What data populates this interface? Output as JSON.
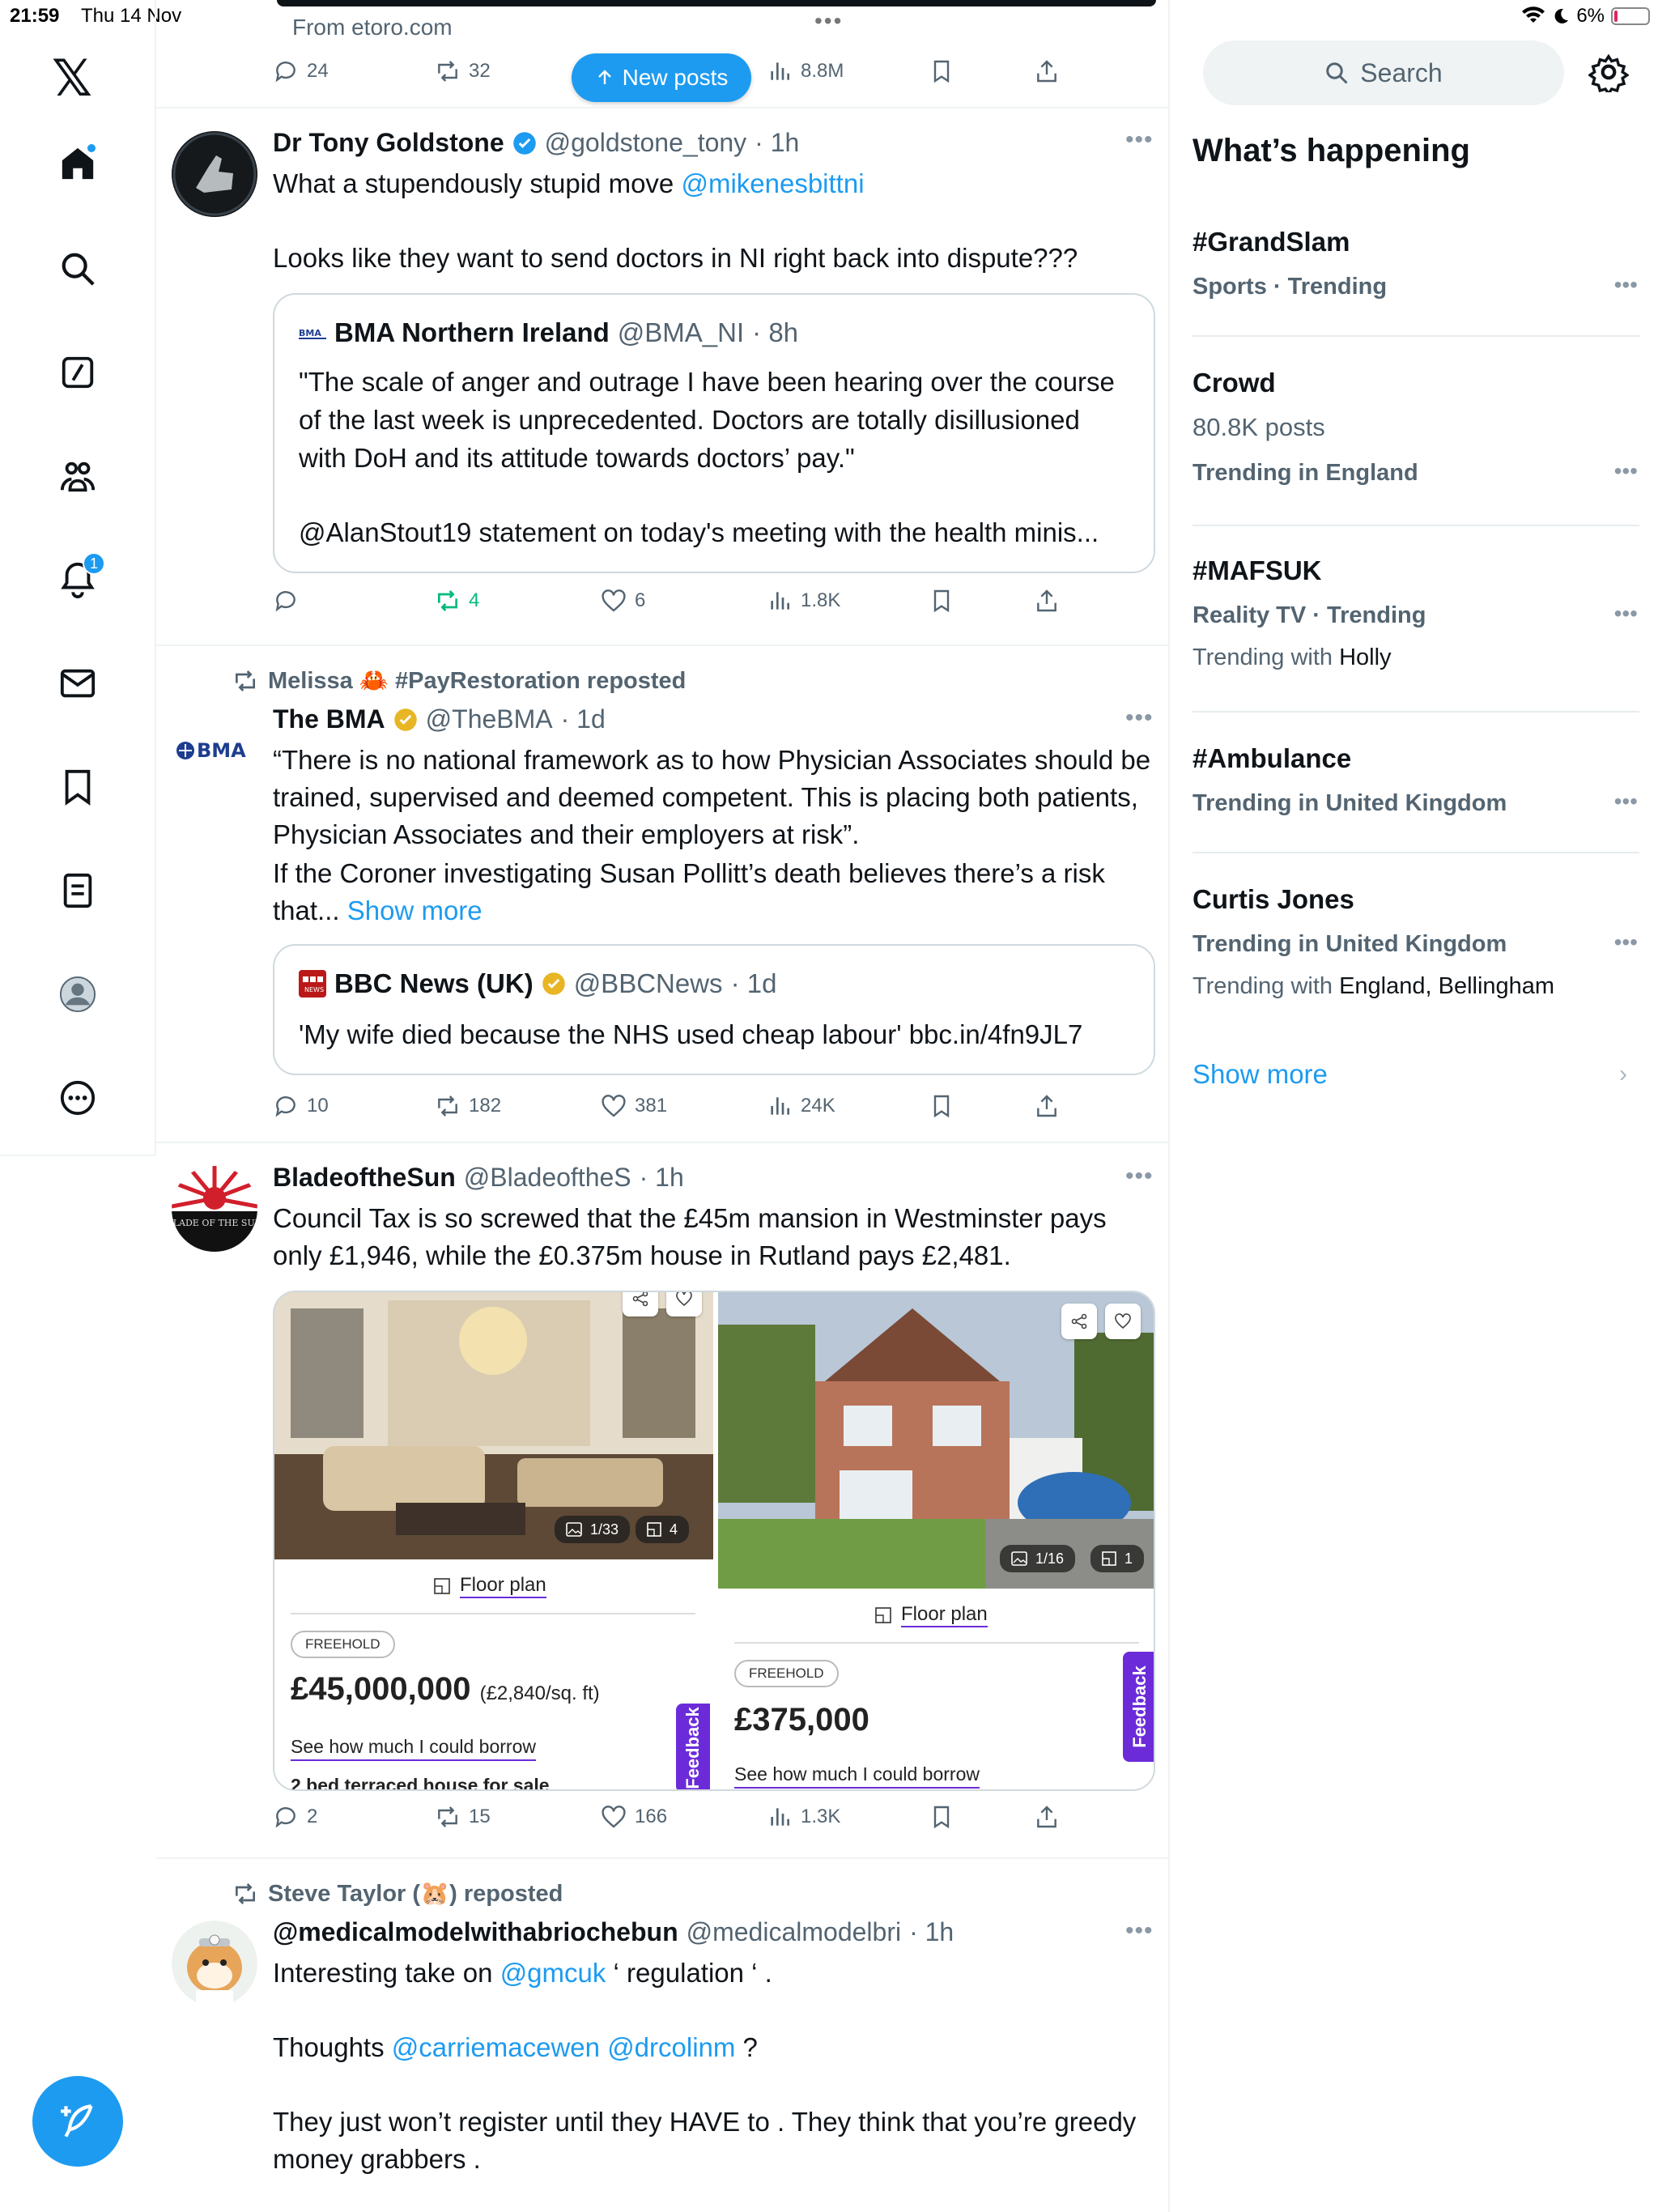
{
  "status_bar": {
    "time": "21:59",
    "date": "Thu 14 Nov",
    "battery": "6%"
  },
  "nav": {
    "notifications_badge": "1"
  },
  "ad": {
    "from": "From etoro.com",
    "replies": "24",
    "reposts": "32",
    "views": "8.8M"
  },
  "new_posts_label": "New posts",
  "search": {
    "placeholder": "Search"
  },
  "tweets": [
    {
      "name": "Dr Tony Goldstone",
      "handle": "@goldstone_tony",
      "time": "· 1h",
      "text_line1": "What a stupendously stupid move ",
      "mention": "@mikenesbittni",
      "text_line2": "Looks like they want to send doctors in NI right back into dispute???",
      "quote": {
        "name": "BMA Northern Ireland",
        "handle": "@BMA_NI",
        "time": "· 8h",
        "text1": "\"The scale of anger and outrage I have been hearing over the course of the last week is unprecedented. Doctors are totally disillusioned with DoH and its attitude towards doctors’ pay.\"",
        "text2": "@AlanStout19 statement on today's meeting with the health minis..."
      },
      "replies": "",
      "reposts": "4",
      "likes": "6",
      "views": "1.8K"
    },
    {
      "repost_by": "Melissa 🦀 #PayRestoration reposted",
      "name": "The BMA",
      "handle": "@TheBMA",
      "time": "· 1d",
      "avatar_text": "BMA",
      "text": "“There is no national framework as to how Physician Associates should be trained, supervised and deemed competent. This is placing both patients, Physician Associates and their employers at risk”.",
      "text2": "If the Coroner investigating Susan Pollitt’s death believes there’s a risk that...",
      "show_more": "Show more",
      "quote": {
        "name": "BBC News (UK)",
        "handle": "@BBCNews",
        "time": "· 1d",
        "text": "'My wife died because the NHS used cheap labour' bbc.in/4fn9JL7"
      },
      "replies": "10",
      "reposts": "182",
      "likes": "381",
      "views": "24K"
    },
    {
      "name": "BladeoftheSun",
      "handle": "@BladeoftheS",
      "time": "· 1h",
      "avatar_text": "BLADE OF THE SUN",
      "text": "Council Tax is so screwed that the £45m mansion in Westminster pays only £1,946, while the £0.375m house in Rutland pays £2,481.",
      "media": {
        "left": {
          "photos": "1/33",
          "plans": "4",
          "floor_plan": "Floor plan",
          "tenure": "FREEHOLD",
          "price": "£45,000,000",
          "price_sqft": "(£2,840/sq. ft)",
          "borrow": "See how much I could borrow",
          "cut_text": "2 bed terraced house for sale",
          "feedback": "Feedback"
        },
        "right": {
          "photos": "1/16",
          "plans": "1",
          "floor_plan": "Floor plan",
          "tenure": "FREEHOLD",
          "price": "£375,000",
          "borrow": "See how much I could borrow",
          "feedback": "Feedback"
        }
      },
      "replies": "2",
      "reposts": "15",
      "likes": "166",
      "views": "1.3K"
    },
    {
      "repost_by": "Steve Taylor (🐹) reposted",
      "name": "@medicalmodelwithabriochebun",
      "handle": "@medicalmodelbri",
      "time": "· 1h",
      "text_a": "Interesting take on ",
      "mention_a": "@gmcuk",
      "text_b": " ‘ regulation ‘ .",
      "text_c": "Thoughts ",
      "mention_c1": "@carriemacewen",
      "mention_c2": "@drcolinm",
      "text_d": " ?",
      "text_e": "They just won’t register until they HAVE to  . They think that you’re greedy money grabbers ."
    }
  ],
  "whats_happening": {
    "title": "What’s happening",
    "trends": [
      {
        "name": "#GrandSlam",
        "meta": "Sports · Trending"
      },
      {
        "name": "Crowd",
        "posts": "80.8K posts",
        "meta": "Trending in England"
      },
      {
        "name": "#MAFSUK",
        "meta": "Reality TV · Trending",
        "with_label": "Trending with",
        "with": "Holly"
      },
      {
        "name": "#Ambulance",
        "meta": "Trending in United Kingdom"
      },
      {
        "name": "Curtis Jones",
        "meta": "Trending in United Kingdom",
        "with_label": "Trending with",
        "with": "England, Bellingham"
      }
    ],
    "show_more": "Show more"
  }
}
